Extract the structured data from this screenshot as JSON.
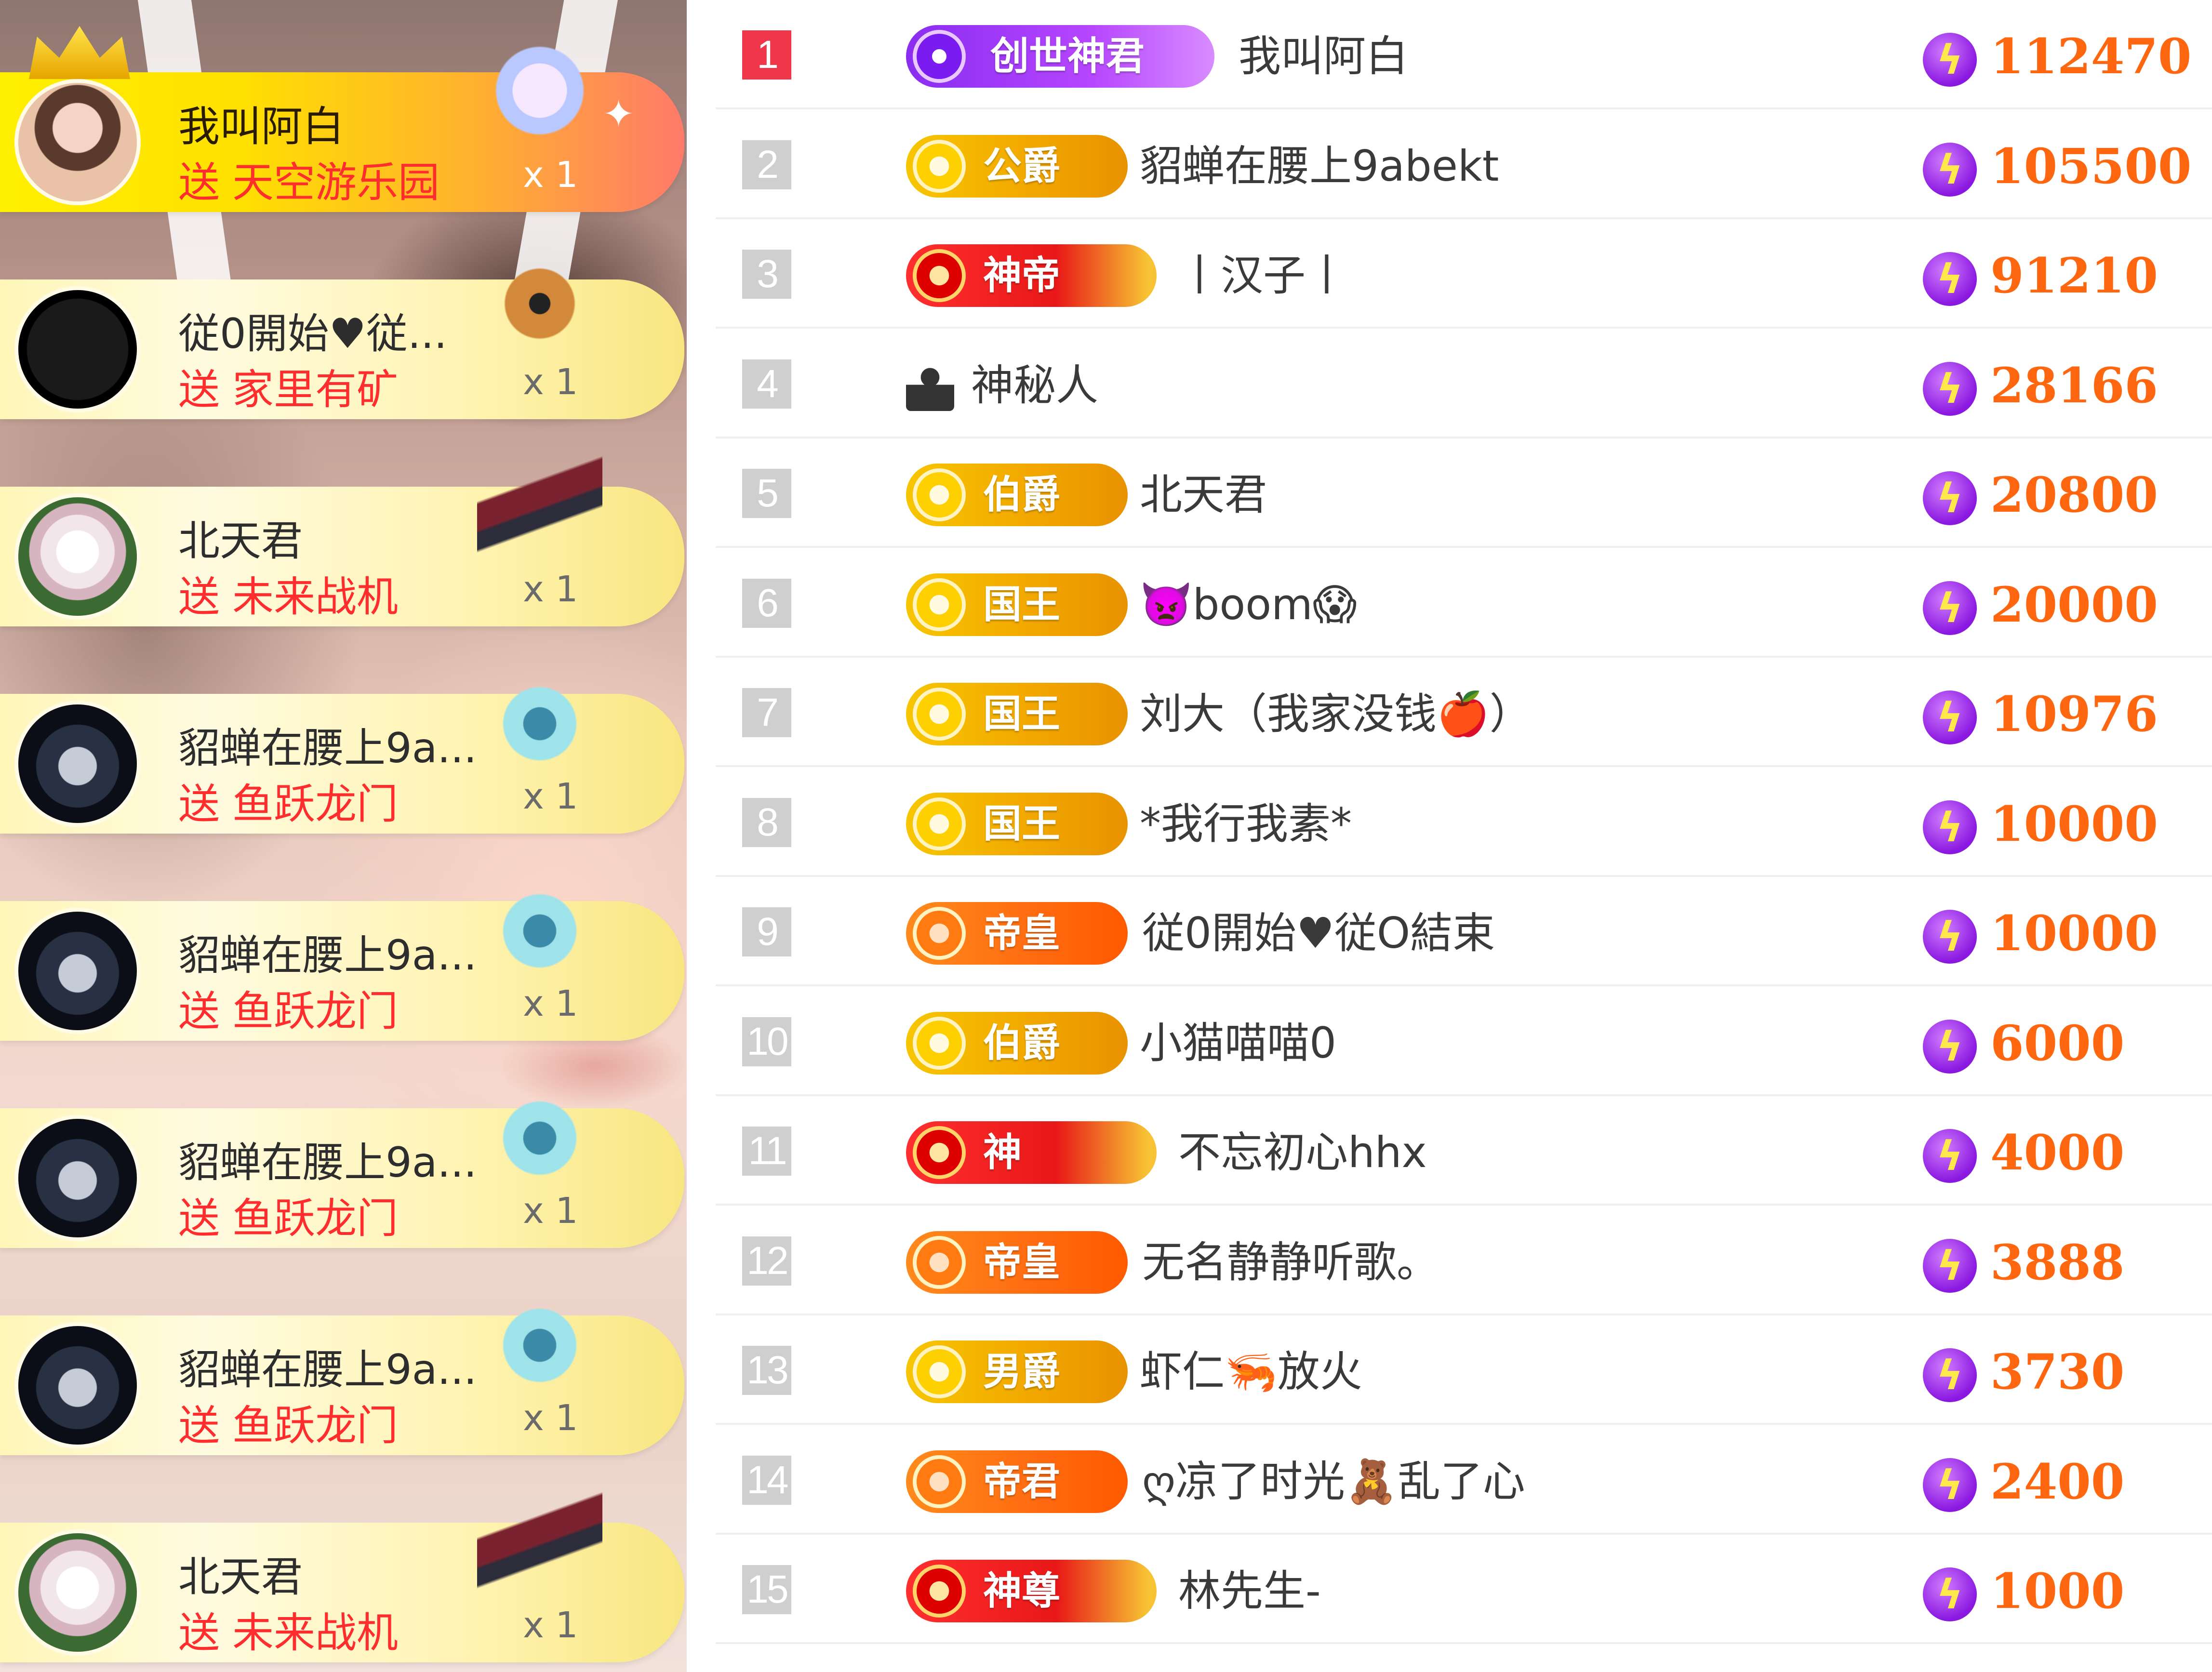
{
  "gift_feed": {
    "send_word": "送",
    "items": [
      {
        "user": "我叫阿白",
        "gift": "天空游乐园",
        "count": "x 1",
        "avatar": "girl-avatar",
        "icon": "sky-park-gift-icon",
        "top": true
      },
      {
        "user": "従0開始♥従...",
        "gift": "家里有矿",
        "count": "x 1",
        "avatar": "dark-avatar",
        "icon": "bear-gift-icon"
      },
      {
        "user": "北天君",
        "gift": "未来战机",
        "count": "x 1",
        "avatar": "lotus-avatar",
        "icon": "fighter-jet-gift-icon"
      },
      {
        "user": "貂蝉在腰上9a...",
        "gift": "鱼跃龙门",
        "count": "x 1",
        "avatar": "masked-avatar",
        "icon": "dragon-gate-gift-icon"
      },
      {
        "user": "貂蝉在腰上9a...",
        "gift": "鱼跃龙门",
        "count": "x 1",
        "avatar": "masked-avatar",
        "icon": "dragon-gate-gift-icon"
      },
      {
        "user": "貂蝉在腰上9a...",
        "gift": "鱼跃龙门",
        "count": "x 1",
        "avatar": "masked-avatar",
        "icon": "dragon-gate-gift-icon"
      },
      {
        "user": "貂蝉在腰上9a...",
        "gift": "鱼跃龙门",
        "count": "x 1",
        "avatar": "masked-avatar",
        "icon": "dragon-gate-gift-icon"
      },
      {
        "user": "北天君",
        "gift": "未来战机",
        "count": "x 1",
        "avatar": "lotus-avatar",
        "icon": "fighter-jet-gift-icon"
      }
    ]
  },
  "ranking": {
    "rows": [
      {
        "rank": "1",
        "badge": "创世神君",
        "badge_style": "purple",
        "name": "我叫阿白",
        "score": "112470"
      },
      {
        "rank": "2",
        "badge": "公爵",
        "badge_style": "gold",
        "name": "貂蝉在腰上9abekt",
        "score": "105500"
      },
      {
        "rank": "3",
        "badge": "神帝",
        "badge_style": "red",
        "name": "丨汉子丨",
        "score": "91210"
      },
      {
        "rank": "4",
        "badge": "",
        "badge_style": "none",
        "name": "神秘人",
        "score": "28166"
      },
      {
        "rank": "5",
        "badge": "伯爵",
        "badge_style": "gold",
        "name": "北天君",
        "score": "20800"
      },
      {
        "rank": "6",
        "badge": "国王",
        "badge_style": "gold",
        "name": "👿boom😱",
        "score": "20000"
      },
      {
        "rank": "7",
        "badge": "国王",
        "badge_style": "gold",
        "name": "刘大（我家没钱🍎）",
        "score": "10976"
      },
      {
        "rank": "8",
        "badge": "国王",
        "badge_style": "gold",
        "name": "*我行我素*",
        "score": "10000"
      },
      {
        "rank": "9",
        "badge": "帝皇",
        "badge_style": "orange",
        "name": "従0開始♥従O結束",
        "score": "10000"
      },
      {
        "rank": "10",
        "badge": "伯爵",
        "badge_style": "gold",
        "name": "小猫喵喵0",
        "score": "6000"
      },
      {
        "rank": "11",
        "badge": "神",
        "badge_style": "red",
        "name": "不忘初心hhx",
        "score": "4000"
      },
      {
        "rank": "12",
        "badge": "帝皇",
        "badge_style": "orange",
        "name": "无名静静听歌。",
        "score": "3888"
      },
      {
        "rank": "13",
        "badge": "男爵",
        "badge_style": "gold",
        "name": "虾仁🦐放火",
        "score": "3730"
      },
      {
        "rank": "14",
        "badge": "帝君",
        "badge_style": "orange",
        "name": "ღ凉了时光🧸乱了心",
        "score": "2400"
      },
      {
        "rank": "15",
        "badge": "神尊",
        "badge_style": "red",
        "name": "林先生-",
        "score": "1000"
      }
    ],
    "score_icon": "lightning-gem-icon",
    "colors": {
      "score": "#ff6610",
      "first_rank": "#f0364a",
      "rank_default": "#cfcfcf"
    }
  }
}
